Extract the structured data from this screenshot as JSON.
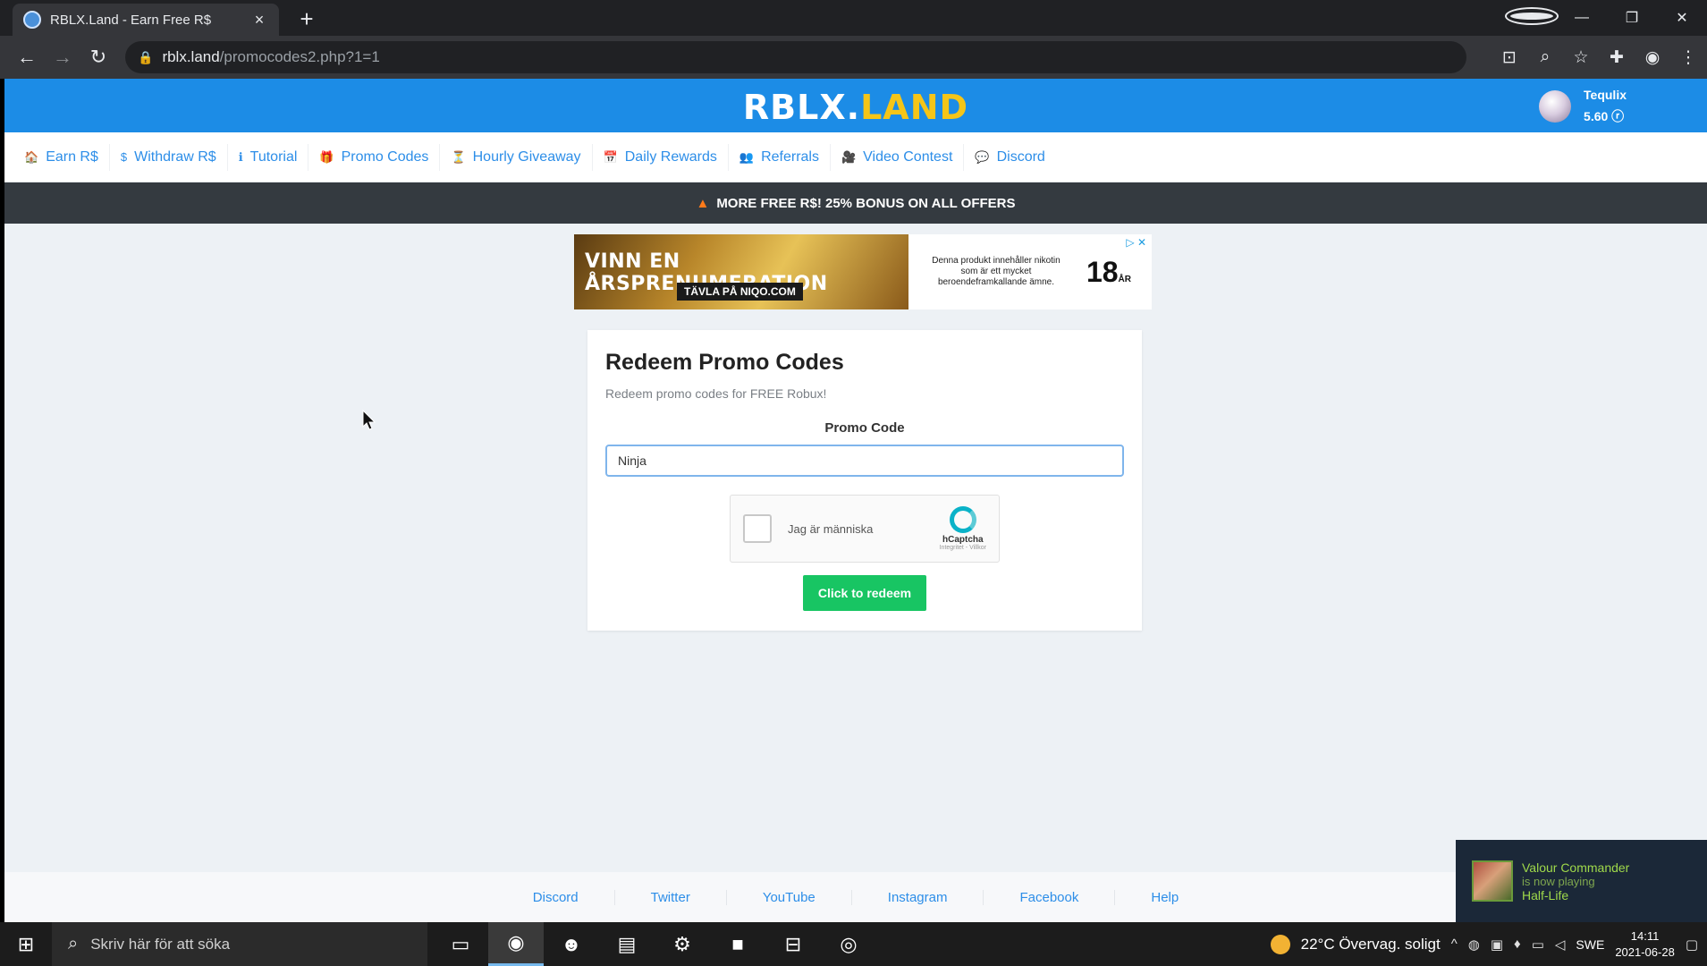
{
  "browser": {
    "tab_title": "RBLX.Land - Earn Free R$",
    "tab_close": "×",
    "new_tab": "+",
    "back": "←",
    "forward": "→",
    "reload": "↻",
    "lock": "🔒",
    "url_host": "rblx.land",
    "url_path": "/promocodes2.php?1=1",
    "minimize": "—",
    "restore": "❐",
    "close": "✕"
  },
  "site": {
    "logo_part1": "RBLX.",
    "logo_part2": "LAND",
    "user": {
      "name": "Tequlix",
      "balance": "5.60 ⓡ"
    },
    "nav": [
      {
        "icon": "🏠",
        "label": "Earn R$"
      },
      {
        "icon": "$",
        "label": "Withdraw R$"
      },
      {
        "icon": "ℹ",
        "label": "Tutorial"
      },
      {
        "icon": "🎁",
        "label": "Promo Codes"
      },
      {
        "icon": "⏳",
        "label": "Hourly Giveaway"
      },
      {
        "icon": "📅",
        "label": "Daily Rewards"
      },
      {
        "icon": "👥",
        "label": "Referrals"
      },
      {
        "icon": "🎥",
        "label": "Video Contest"
      },
      {
        "icon": "💬",
        "label": "Discord"
      }
    ],
    "banner": "MORE FREE R$! 25% BONUS ON ALL OFFERS",
    "ad": {
      "headline": "VINN EN ÅRSPRENUMERATION",
      "cta": "TÄVLA PÅ NIQO.COM",
      "warning": "Denna produkt innehåller nikotin som är ett mycket beroendeframkallande ämne.",
      "age": "18",
      "age_suffix": "ÅR",
      "adchoices": "▷ ✕"
    },
    "card": {
      "title": "Redeem Promo Codes",
      "subtitle": "Redeem promo codes for FREE Robux!",
      "field_label": "Promo Code",
      "input_value": "Ninja",
      "captcha_label": "Jag är människa",
      "captcha_brand": "hCaptcha",
      "captcha_terms": "Integritet - Villkor",
      "button": "Click to redeem"
    },
    "footer": [
      "Discord",
      "Twitter",
      "YouTube",
      "Instagram",
      "Facebook",
      "Help"
    ]
  },
  "toast": {
    "name": "Valour Commander",
    "status": "is now playing",
    "game": "Half-Life"
  },
  "taskbar": {
    "search_placeholder": "Skriv här för att söka",
    "weather": "22°C  Övervag. soligt",
    "lang": "SWE",
    "time": "14:11",
    "date": "2021-06-28"
  }
}
